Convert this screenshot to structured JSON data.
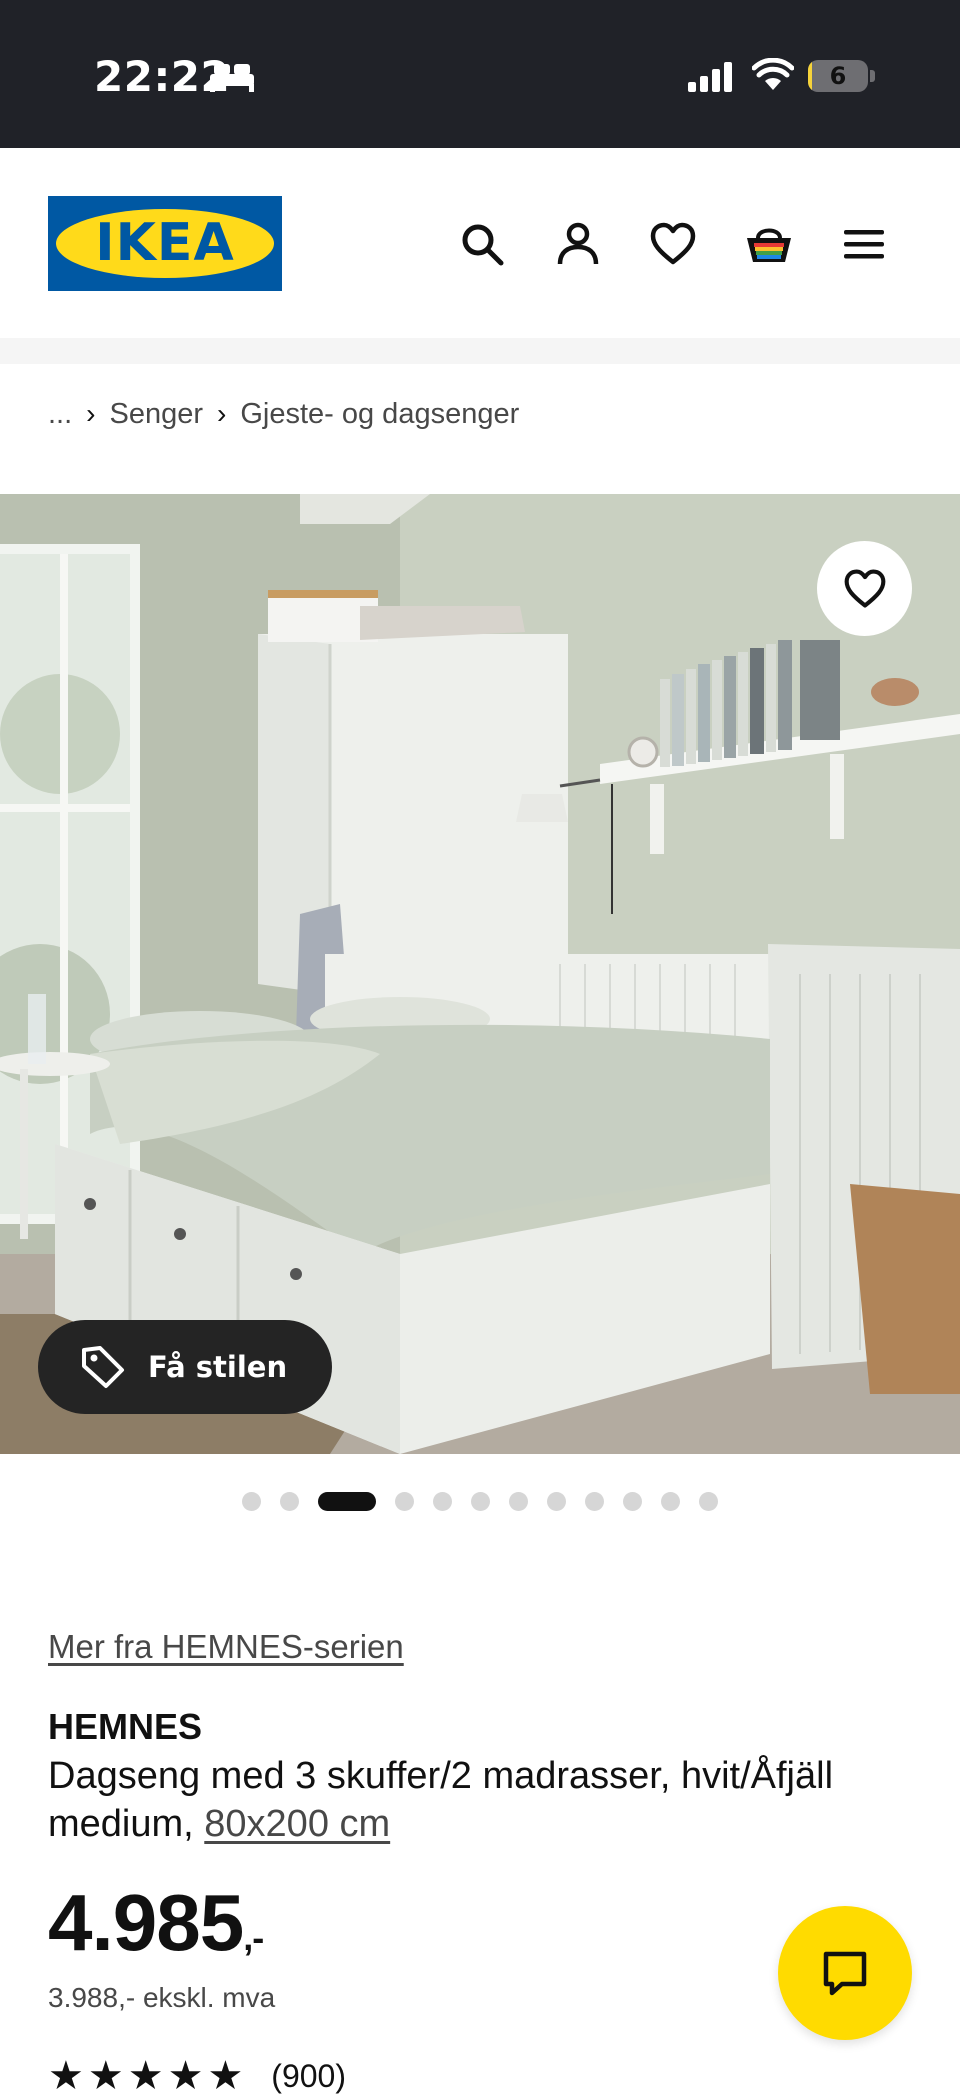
{
  "status_bar": {
    "time": "22:22",
    "battery_level": "6",
    "battery_fraction": 0.06,
    "icons": [
      "bed-icon",
      "signal-icon",
      "wifi-icon",
      "battery-icon"
    ]
  },
  "header": {
    "logo_text": "IKEA",
    "icons": [
      "search-icon",
      "account-icon",
      "heart-icon",
      "basket-icon",
      "menu-icon"
    ]
  },
  "breadcrumb": {
    "items": [
      "...",
      "Senger",
      "Gjeste- og dagsenger"
    ]
  },
  "gallery": {
    "style_button_label": "Få stilen",
    "dot_count": 12,
    "active_index": 2
  },
  "product": {
    "series_link": "Mer fra HEMNES-serien",
    "name": "HEMNES",
    "description": "Dagseng med 3 skuffer/2 madrasser, hvit/Åfjäll medium,",
    "size": "80x200 cm",
    "price": "4.985",
    "price_suffix": ",-",
    "price_ex_vat": "3.988,- ekskl. mva",
    "rating_stars": "★★★★★",
    "rating_value": 4.5,
    "rating_count": "(900)"
  },
  "colors": {
    "brand_blue": "#0058a3",
    "brand_yellow": "#ffda1a",
    "chat_yellow": "#ffdb00",
    "status_bar_bg": "#202228"
  }
}
